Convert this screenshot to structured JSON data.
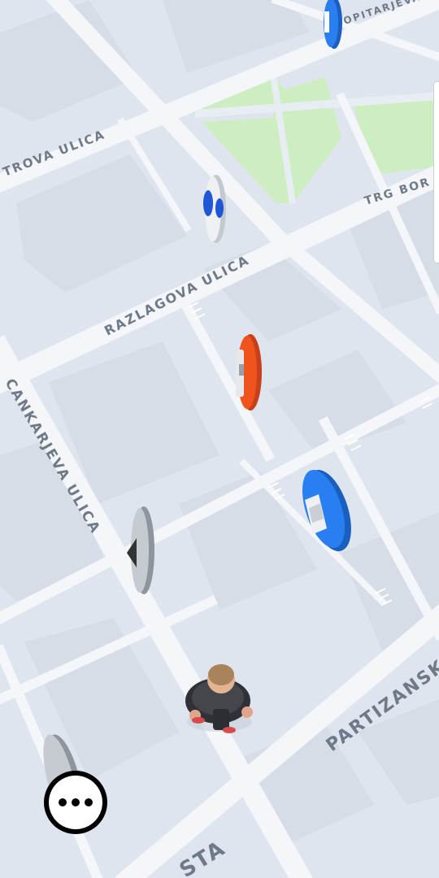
{
  "streets": {
    "trova": "TROVA ULICA",
    "topitarjeva": "OPITARJEVA",
    "trg": "TRG BOR",
    "razlagova": "RAZLAGOVA ULICA",
    "cankarjeva": "CANKARJEVA ULICA",
    "partizanska": "PARTIZANSK",
    "cesta": "STA"
  },
  "colors": {
    "map_bg": "#dfe5ee",
    "road": "#f4f6f9",
    "park": "#cdeec0",
    "marker_blue": "#1f73e0",
    "marker_orange": "#f0541e",
    "marker_gray": "#b8bdc4"
  },
  "markers": [
    {
      "name": "map-marker-blue-top",
      "color": "blue"
    },
    {
      "name": "map-marker-blue-upper",
      "color": "blue"
    },
    {
      "name": "map-marker-orange",
      "color": "orange"
    },
    {
      "name": "map-marker-blue-large",
      "color": "blue"
    },
    {
      "name": "map-marker-gray-middle",
      "color": "gray"
    },
    {
      "name": "map-marker-gray-bottom",
      "color": "gray"
    }
  ],
  "menu_button": {
    "icon": "more-dots-icon"
  }
}
